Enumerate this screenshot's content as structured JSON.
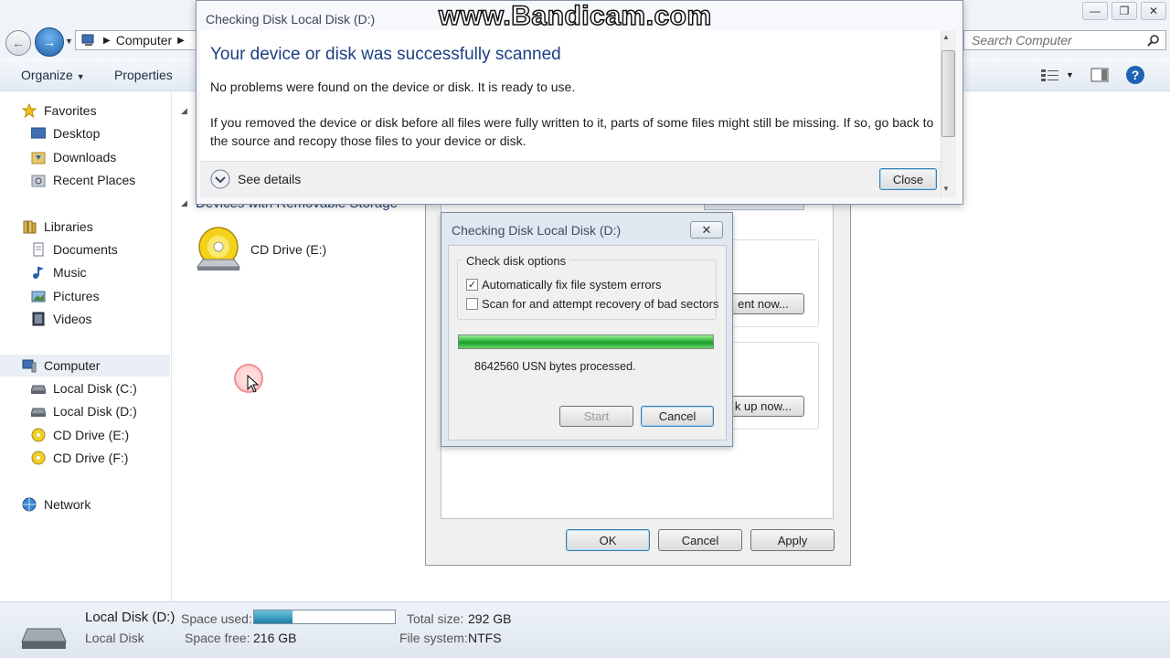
{
  "watermark": "www.Bandicam.com",
  "explorer": {
    "address": {
      "location": "Computer"
    },
    "search": {
      "placeholder": "Search Computer"
    },
    "toolbar": {
      "organize": "Organize",
      "properties": "Properties"
    },
    "nav": {
      "favorites": "Favorites",
      "desktop": "Desktop",
      "downloads": "Downloads",
      "recent_places": "Recent Places",
      "libraries": "Libraries",
      "documents": "Documents",
      "music": "Music",
      "pictures": "Pictures",
      "videos": "Videos",
      "computer": "Computer",
      "local_disk_c": "Local Disk (C:)",
      "local_disk_d": "Local Disk (D:)",
      "cd_drive_e": "CD Drive (E:)",
      "cd_drive_f": "CD Drive (F:)",
      "network": "Network"
    },
    "content": {
      "section_title": "Devices with Removable Storage",
      "cd_drive_e": "CD Drive (E:)"
    },
    "details": {
      "name": "Local Disk (D:)",
      "type": "Local Disk",
      "space_used_label": "Space used:",
      "space_used_fraction": 0.27,
      "space_free_label": "Space free:",
      "space_free_value": "216 GB",
      "total_size_label": "Total size:",
      "total_size_value": "292 GB",
      "file_system_label": "File system:",
      "file_system_value": "NTFS"
    }
  },
  "properties_dialog": {
    "partial_button_1": "ent now...",
    "partial_button_2": "k up now...",
    "ok": "OK",
    "cancel": "Cancel",
    "apply": "Apply"
  },
  "check_disk_dialog": {
    "title": "Checking Disk Local Disk (D:)",
    "group_label": "Check disk options",
    "option_fix": "Automatically fix file system errors",
    "option_fix_checked": true,
    "option_scan": "Scan for and attempt recovery of bad sectors",
    "option_scan_checked": false,
    "progress_fraction": 1.0,
    "status": "8642560 USN bytes processed.",
    "start": "Start",
    "cancel": "Cancel"
  },
  "notification": {
    "title": "Checking Disk Local Disk (D:)",
    "heading": "Your device or disk was successfully scanned",
    "message1": "No problems were found on the device or disk. It is ready to use.",
    "message2": "If you removed the device or disk before all files were fully written to it, parts of some files might still be missing. If so, go back to the source and recopy those files to your device or disk.",
    "see_details": "See details",
    "close": "Close"
  },
  "colors": {
    "accent": "#1d3f82",
    "progress_green": "#2bb53a",
    "space_bar": "#2a8fb0"
  }
}
